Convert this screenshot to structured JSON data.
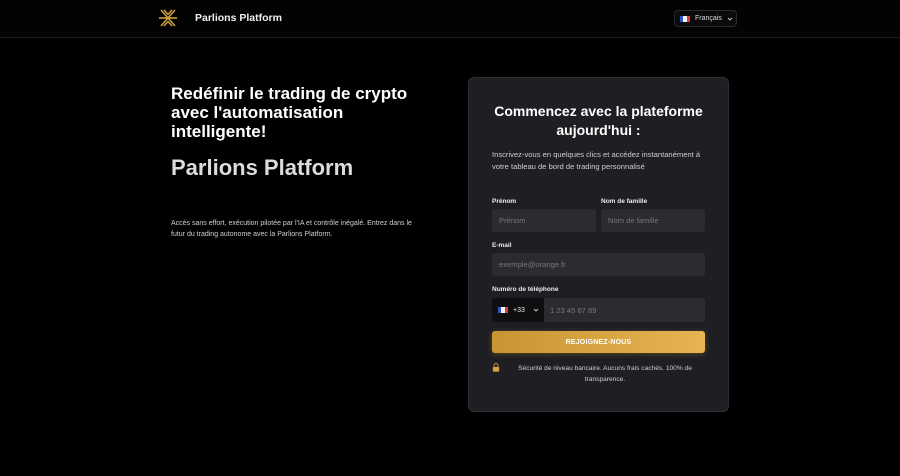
{
  "header": {
    "brand_name": "Parlions Platform",
    "logo_icon": "gold-geometric-logo-icon",
    "language": "Français",
    "language_flag_icon": "french-flag-icon"
  },
  "hero": {
    "title": "Redéfinir le trading de crypto avec l'automatisation intelligente!",
    "brand": "Parlions Platform",
    "description": "Accès sans effort, exécution pilotée par l'IA et contrôle inégalé. Entrez dans le futur du trading autonome avec la Parlions Platform."
  },
  "form": {
    "title": "Commencez avec la plateforme aujourd'hui :",
    "subtitle": "Inscrivez-vous en quelques clics et accédez instantanément à votre tableau de bord de trading personnalisé",
    "first_name_label": "Prénom",
    "first_name_placeholder": "Prénom",
    "first_name_value": "",
    "last_name_label": "Nom de famille",
    "last_name_placeholder": "Nom de famille",
    "last_name_value": "",
    "email_label": "E-mail",
    "email_placeholder": "exemple@orange.fr",
    "email_value": "",
    "phone_label": "Numéro de téléphone",
    "phone_code": "+33",
    "phone_placeholder": "1 23 45 67 89",
    "phone_value": "",
    "submit_label": "REJOIGNEZ-NOUS",
    "security_note": "Sécurité de niveau bancaire. Aucuns frais cachés. 100% de transparence.",
    "security_icon": "lock-icon"
  },
  "colors": {
    "background": "#000000",
    "card": "#1e1e23",
    "input": "#2b2b31",
    "accent_gold": "#d9a441"
  }
}
